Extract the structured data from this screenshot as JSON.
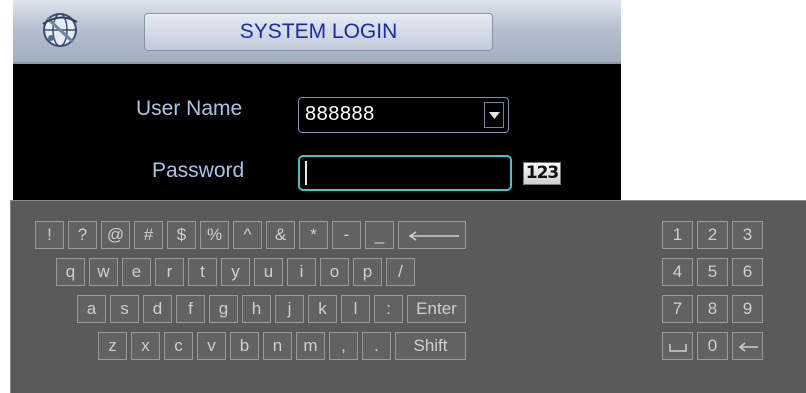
{
  "login": {
    "title": "SYSTEM LOGIN",
    "user_name_label": "User Name",
    "user_name_value": "888888",
    "password_label": "Password",
    "password_value": "",
    "input_mode_icon_text": "123",
    "logo_icon": "globe-logo-icon",
    "dropdown_icon": "chevron-down-icon"
  },
  "keyboard": {
    "main_rows": [
      [
        "!",
        "?",
        "@",
        "#",
        "$",
        "%",
        "^",
        "&",
        "*",
        "-",
        "_",
        "backspace"
      ],
      [
        "q",
        "w",
        "e",
        "r",
        "t",
        "y",
        "u",
        "i",
        "o",
        "p",
        "/"
      ],
      [
        "a",
        "s",
        "d",
        "f",
        "g",
        "h",
        "j",
        "k",
        "l",
        ":",
        "Enter"
      ],
      [
        "z",
        "x",
        "c",
        "v",
        "b",
        "n",
        "m",
        ",",
        ".",
        "Shift"
      ]
    ],
    "numpad_rows": [
      [
        "1",
        "2",
        "3"
      ],
      [
        "4",
        "5",
        "6"
      ],
      [
        "7",
        "8",
        "9"
      ],
      [
        "space",
        "0",
        "backspace"
      ]
    ],
    "special_keys": {
      "backspace": "left-arrow-icon",
      "space": "space-icon"
    }
  },
  "colors": {
    "title_text": "#1a2ab0",
    "label_text": "#a9c4e6",
    "focus_border": "#3ec3d0",
    "keyboard_bg": "#5a5a5a",
    "key_text": "#cfcfcf"
  }
}
